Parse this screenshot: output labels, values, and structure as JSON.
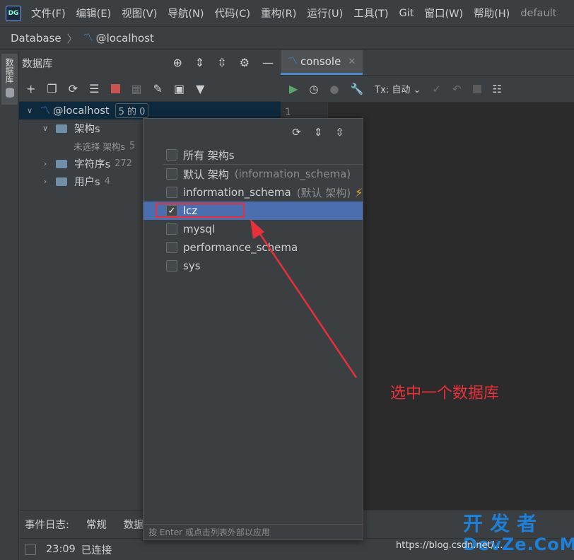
{
  "menu": {
    "items": [
      "文件(F)",
      "编辑(E)",
      "视图(V)",
      "导航(N)",
      "代码(C)",
      "重构(R)",
      "运行(U)",
      "工具(T)",
      "Git",
      "窗口(W)",
      "帮助(H)",
      "default"
    ]
  },
  "breadcrumb": {
    "root": "Database",
    "host": "@localhost"
  },
  "sidebar": {
    "tab": "数据库"
  },
  "db_panel": {
    "title": "数据库",
    "tree": {
      "host": "@localhost",
      "host_badge": "5 的 0",
      "schemas": "架构s",
      "no_selection": "未选择 架构s",
      "no_selection_count": "5",
      "collations": "字符序s",
      "collations_count": "272",
      "users": "用户s",
      "users_count": "4"
    }
  },
  "console": {
    "tab": "console",
    "tx_label": "Tx: 自动",
    "line1": "1"
  },
  "popup": {
    "items": [
      {
        "label": "所有 架构s",
        "hint": "",
        "checked": false
      },
      {
        "label": "默认 架构",
        "hint": "(information_schema)",
        "checked": false
      },
      {
        "label": "information_schema",
        "hint": "(默认 架构)",
        "checked": false
      },
      {
        "label": "lcz",
        "hint": "",
        "checked": true
      },
      {
        "label": "mysql",
        "hint": "",
        "checked": false
      },
      {
        "label": "performance_schema",
        "hint": "",
        "checked": false
      },
      {
        "label": "sys",
        "hint": "",
        "checked": false
      }
    ],
    "footer": "按 Enter 或点击列表外部以应用"
  },
  "bottom": {
    "tab1": "事件日志:",
    "tab2": "常规",
    "tab3": "数据"
  },
  "status": {
    "time": "23:09",
    "text": "已连接"
  },
  "annotation": {
    "text": "选中一个数据库"
  },
  "watermark": {
    "url": "https://blog.csdn.net/...",
    "brand_cn": "开发者",
    "brand_en": "DevZe.CoM"
  },
  "colors": {
    "accent": "#4b6eaf",
    "annotation": "#e8303a",
    "run": "#59a869"
  }
}
